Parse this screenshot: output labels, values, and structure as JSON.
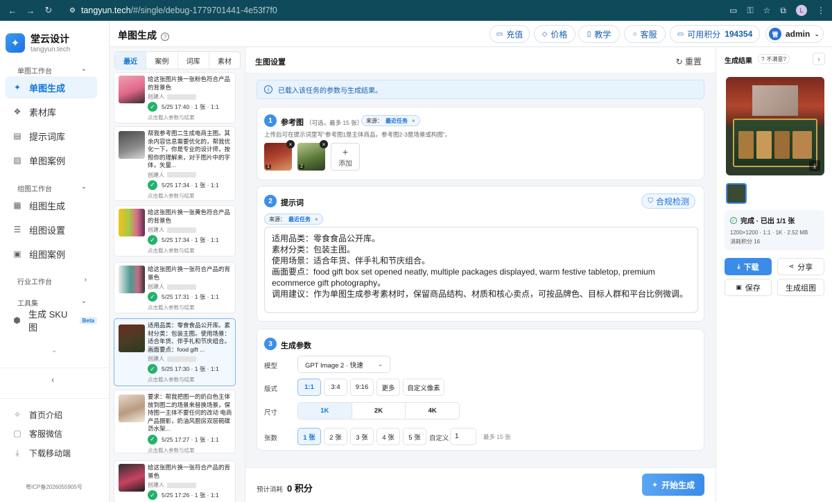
{
  "browser": {
    "url_host": "tangyun.tech",
    "url_path": "/#/single/debug-1779701441-4e53f7f0",
    "profile_initial": "L"
  },
  "brand": {
    "name": "堂云设计",
    "domain": "tangyun.tech"
  },
  "sidebar": {
    "group_single": "单图工作台",
    "item_single_gen": "单图生成",
    "item_assets": "素材库",
    "item_prompts": "提示词库",
    "item_single_cases": "单图案例",
    "group_group": "组图工作台",
    "item_group_gen": "组图生成",
    "item_group_settings": "组图设置",
    "item_group_cases": "组图案例",
    "group_industry": "行业工作台",
    "group_tools": "工具集",
    "item_sku": "生成 SKU 图",
    "beta": "Beta",
    "footer_home": "首页介绍",
    "footer_wechat": "客服微信",
    "footer_mobile": "下载移动端",
    "icp": "粤ICP备2026055905号"
  },
  "header": {
    "title": "单图生成",
    "recharge": "充值",
    "price": "价格",
    "tutorial": "教学",
    "service": "客服",
    "points_label": "可用积分",
    "points_value": "194354",
    "admin_initial": "管",
    "admin_name": "admin"
  },
  "history": {
    "tabs": [
      "最近",
      "案例",
      "词库",
      "素材"
    ],
    "creator_label": "创建人",
    "load_hint": "点击载入参数与结果",
    "cards": [
      {
        "text": "给这张图片换一张粉色符合产品的背景色",
        "meta": "5/25 17:40 · 1 张 · 1:1"
      },
      {
        "text": "帮我参考图二生成电商主图。其余内容信息需要优化的，帮我优化一下，你是专业的设计师，按照你的理解来，对于图片中的字体，矢量...",
        "meta": "5/25 17:34 · 1 张 · 1:1"
      },
      {
        "text": "给这张图片换一张黄色符合产品的背景色",
        "meta": "5/25 17:34 · 1 张 · 1:1"
      },
      {
        "text": "给这张图片换一张符合产品的背景色",
        "meta": "5/25 17:31 · 1 张 · 1:1"
      },
      {
        "text": "适用品类：零食食品公开库。素材分类：包装主图。使用场景：适合年货、伴手礼和节庆组合。画面要点：food gift ...",
        "meta": "5/25 17:30 · 1 张 · 1:1"
      },
      {
        "text": "要求：帮我把图一的奶白色主体放到图二的场景来替换场景，保持图一主体不要任何的改动 电商产品摄影，奶油风厨房双层碗碟沥水架...",
        "meta": "5/25 17:27 · 1 张 · 1:1"
      },
      {
        "text": "给这张图片换一张符合产品的背景色",
        "meta": "5/25 17:26 · 1 张 · 1:1"
      }
    ]
  },
  "main": {
    "title": "生图设置",
    "reset": "重置",
    "notice": "已载入该任务的参数与生成结果。",
    "ref": {
      "num": "1",
      "title": "参考图",
      "hint": "（可选，最多 15 张）",
      "src_label": "来源：",
      "src_value": "最近任务",
      "desc": "上传后可在提示词里写“参考图1是主体商品，参考图2-3是场景或构图”。",
      "img1": "1",
      "img2": "2",
      "add": "添加"
    },
    "prompt": {
      "num": "2",
      "title": "提示词",
      "compliance": "合规检测",
      "src_label": "来源：",
      "src_value": "最近任务",
      "lines": [
        "适用品类：零食食品公开库。",
        "素材分类：包装主图。",
        "使用场景：适合年货、伴手礼和节庆组合。",
        "画面要点：food gift box set opened neatly, multiple packages displayed, warm festive tabletop, premium ecommerce gift photography。",
        "调用建议：作为单图生成参考素材时，保留商品结构、材质和核心卖点，可按品牌色、目标人群和平台比例微调。"
      ]
    },
    "params": {
      "num": "3",
      "title": "生成参数",
      "model_label": "模型",
      "model_value": "GPT Image 2 · 快速",
      "ratio_label": "版式",
      "ratios": [
        "1:1",
        "3:4",
        "9:16",
        "更多",
        "自定义像素"
      ],
      "size_label": "尺寸",
      "sizes": [
        "1K",
        "2K",
        "4K"
      ],
      "count_label": "张数",
      "counts": [
        "1 张",
        "2 张",
        "3 张",
        "4 张",
        "5 张"
      ],
      "custom_label": "自定义",
      "custom_value": "1",
      "max_hint": "最多 15 张"
    },
    "footer": {
      "cost_label": "预计消耗",
      "cost_value": "0 积分",
      "start": "开始生成"
    }
  },
  "result": {
    "title": "生成结果",
    "unsatisfied": "不满意?",
    "status": "完成 · 已出 1/1 张",
    "spec": "1200×1200 · 1:1 · 1K · 2.52 MB",
    "points": "消耗积分 16",
    "download": "下载",
    "share": "分享",
    "save": "保存",
    "to_group": "生成组图"
  }
}
